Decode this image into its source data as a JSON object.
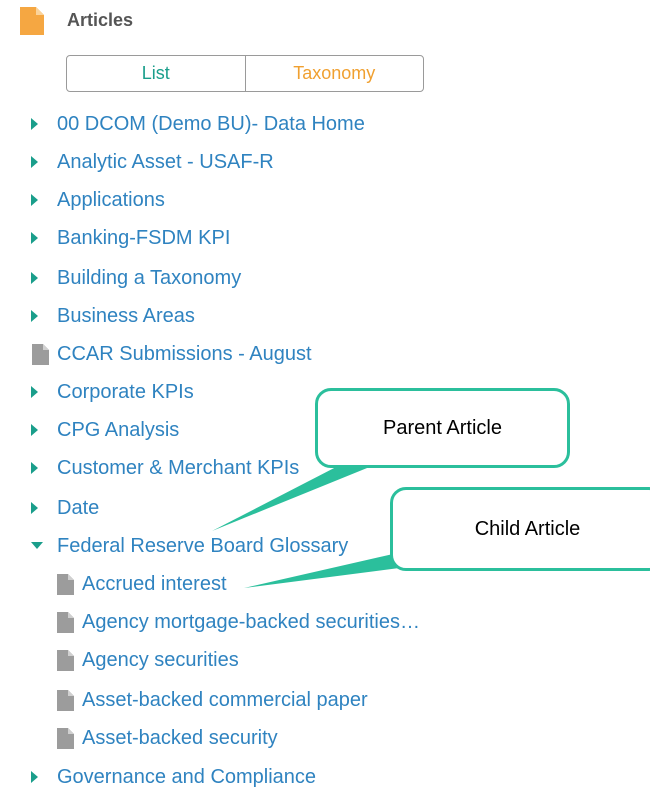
{
  "header": {
    "title": "Articles",
    "icon": "document-icon"
  },
  "view_toggle": {
    "list_label": "List",
    "taxonomy_label": "Taxonomy"
  },
  "tree": {
    "items": [
      {
        "label": "00 DCOM (Demo BU)- Data Home",
        "kind": "folder",
        "state": "collapsed"
      },
      {
        "label": "Analytic Asset - USAF-R",
        "kind": "folder",
        "state": "collapsed"
      },
      {
        "label": "Applications",
        "kind": "folder",
        "state": "collapsed"
      },
      {
        "label": "Banking-FSDM KPI",
        "kind": "folder",
        "state": "collapsed"
      },
      {
        "label": "Building a Taxonomy",
        "kind": "folder",
        "state": "collapsed"
      },
      {
        "label": "Business Areas",
        "kind": "folder",
        "state": "collapsed"
      },
      {
        "label": "CCAR Submissions - August",
        "kind": "article"
      },
      {
        "label": "Corporate KPIs",
        "kind": "folder",
        "state": "collapsed"
      },
      {
        "label": "CPG Analysis",
        "kind": "folder",
        "state": "collapsed"
      },
      {
        "label": "Customer & Merchant KPIs",
        "kind": "folder",
        "state": "collapsed"
      },
      {
        "label": "Date",
        "kind": "folder",
        "state": "collapsed"
      },
      {
        "label": "Federal Reserve Board Glossary",
        "kind": "folder",
        "state": "expanded"
      }
    ],
    "children": [
      {
        "label": "Accrued interest",
        "kind": "article"
      },
      {
        "label": "Agency mortgage-backed securities…",
        "kind": "article"
      },
      {
        "label": "Agency securities",
        "kind": "article"
      },
      {
        "label": "Asset-backed commercial paper",
        "kind": "article"
      },
      {
        "label": "Asset-backed security",
        "kind": "article"
      }
    ],
    "trailing": {
      "label": "Governance and Compliance",
      "kind": "folder",
      "state": "collapsed"
    }
  },
  "callouts": {
    "parent": "Parent Article",
    "child": "Child Article"
  },
  "colors": {
    "accent_teal": "#1a9e8b",
    "accent_orange": "#f0a030",
    "link_blue": "#2f83c0",
    "callout_border": "#2bbf9c",
    "doc_gray": "#9c9c9c"
  }
}
